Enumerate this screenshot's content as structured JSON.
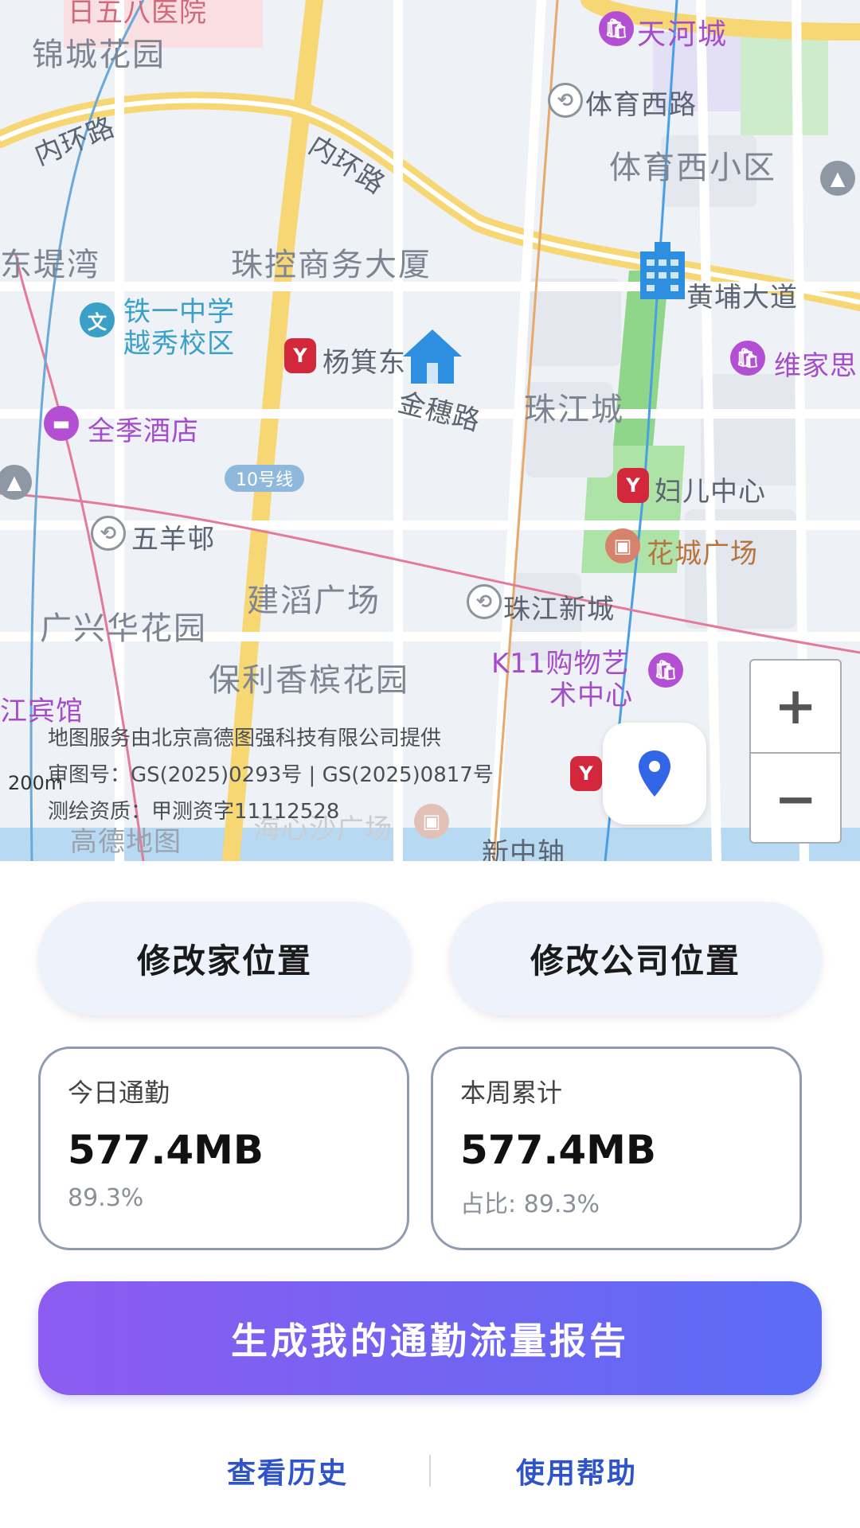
{
  "map": {
    "labels": {
      "jincheng": "锦城花园",
      "huanlu_left": "内环路",
      "huanlu_mid": "内环路",
      "tianhe": "天河城",
      "tiyu_road": "体育西路",
      "tiyu_district": "体育西小区",
      "dongti": "东堤湾",
      "zhukong": "珠控商务大厦",
      "tieyi_1": "铁一中学",
      "tieyi_2": "越秀校区",
      "yangji": "杨箕东",
      "huangpu": "黄埔大道",
      "weijia": "维家思",
      "jinsui": "金穗路",
      "zhujiang_city": "珠江城",
      "quanji": "全季酒店",
      "line10": "10号线",
      "fuer": "妇儿中心",
      "wuyang": "五羊邨",
      "huacheng": "花城广场",
      "jiandao": "建滔广场",
      "guangxing": "广兴华花园",
      "zhujiang_new": "珠江新城",
      "k11_1": "K11购物艺",
      "k11_2": "术中心",
      "baoli": "保利香槟花园",
      "jiang": "江宾馆",
      "haixin": "海心沙广场",
      "xinzhong": "新中轴",
      "gaode": "高德地图",
      "hospital_partial": "日五八医院"
    },
    "attribution": {
      "line1": "地图服务由北京高德图强科技有限公司提供",
      "line2": "审图号：GS(2025)0293号 | GS(2025)0817号",
      "line3": "测绘资质：甲测资字11112528"
    },
    "scale": "200m",
    "zoom_in": "+",
    "zoom_out": "−"
  },
  "actions": {
    "edit_home": "修改家位置",
    "edit_company": "修改公司位置"
  },
  "stats": {
    "today": {
      "title": "今日通勤",
      "value": "577.4MB",
      "sub": "89.3%"
    },
    "week": {
      "title": "本周累计",
      "value": "577.4MB",
      "sub": "占比: 89.3%"
    }
  },
  "cta": "生成我的通勤流量报告",
  "footer": {
    "history": "查看历史",
    "help": "使用帮助"
  },
  "colors": {
    "accent_start": "#8d5bf0",
    "accent_end": "#5b6cf5",
    "link": "#2f54c9",
    "metro_red": "#d3283b",
    "poi_purple": "#a44cc9"
  }
}
